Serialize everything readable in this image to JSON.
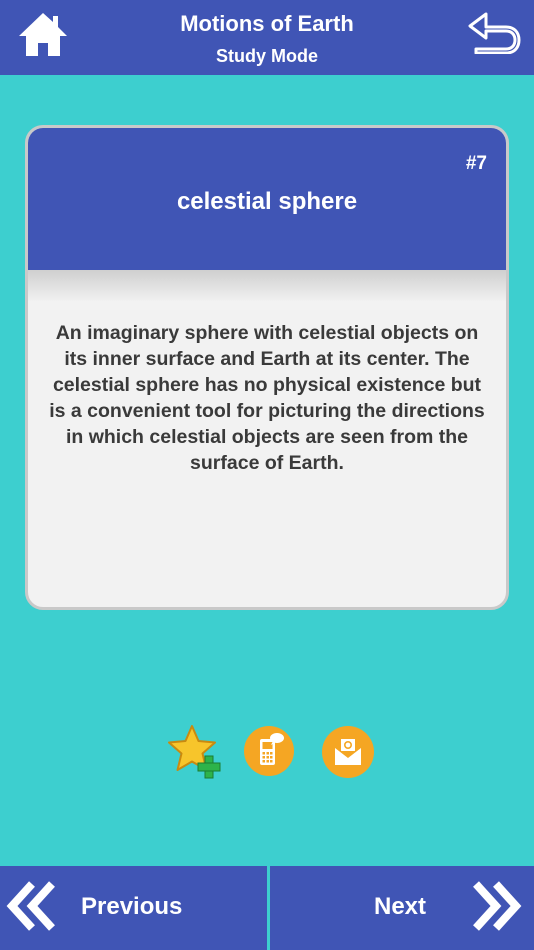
{
  "header": {
    "title": "Motions of Earth",
    "subtitle": "Study Mode",
    "home_icon": "home-icon",
    "back_icon": "return-arrow-icon"
  },
  "card": {
    "number": "#7",
    "term": "celestial sphere",
    "definition": "An imaginary sphere with celestial objects on its inner surface and Earth at its center. The celestial sphere has no physical existence but is a convenient tool for picturing the directions in which celestial objects are seen from the surface of Earth."
  },
  "actions": {
    "favorite_icon": "star-add-icon",
    "sms_icon": "sms-phone-icon",
    "email_icon": "email-icon"
  },
  "footer": {
    "previous_label": "Previous",
    "next_label": "Next"
  },
  "colors": {
    "background": "#3dcfcf",
    "primary": "#4055b5",
    "card": "#f2f2f2",
    "action_orange": "#f5a623"
  }
}
